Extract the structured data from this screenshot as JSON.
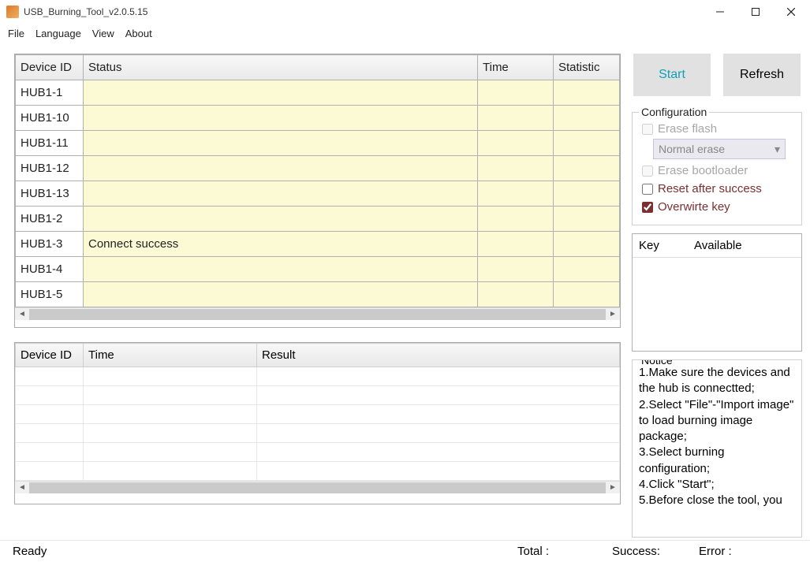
{
  "window": {
    "title": "USB_Burning_Tool_v2.0.5.15"
  },
  "menu": {
    "file": "File",
    "language": "Language",
    "view": "View",
    "about": "About"
  },
  "table1": {
    "headers": {
      "device": "Device ID",
      "status": "Status",
      "time": "Time",
      "statistic": "Statistic"
    },
    "rows": [
      {
        "device": "HUB1-1",
        "status": "",
        "time": "",
        "stat": ""
      },
      {
        "device": "HUB1-10",
        "status": "",
        "time": "",
        "stat": ""
      },
      {
        "device": "HUB1-11",
        "status": "",
        "time": "",
        "stat": ""
      },
      {
        "device": "HUB1-12",
        "status": "",
        "time": "",
        "stat": ""
      },
      {
        "device": "HUB1-13",
        "status": "",
        "time": "",
        "stat": ""
      },
      {
        "device": "HUB1-2",
        "status": "",
        "time": "",
        "stat": ""
      },
      {
        "device": "HUB1-3",
        "status": "Connect success",
        "time": "",
        "stat": ""
      },
      {
        "device": "HUB1-4",
        "status": "",
        "time": "",
        "stat": ""
      },
      {
        "device": "HUB1-5",
        "status": "",
        "time": "",
        "stat": ""
      }
    ]
  },
  "table2": {
    "headers": {
      "device": "Device ID",
      "time": "Time",
      "result": "Result"
    }
  },
  "buttons": {
    "start": "Start",
    "refresh": "Refresh"
  },
  "config": {
    "title": "Configuration",
    "erase_flash": "Erase flash",
    "erase_mode": "Normal erase",
    "erase_bootloader": "Erase bootloader",
    "reset": "Reset after success",
    "overwrite": "Overwirte key"
  },
  "keybox": {
    "key": "Key",
    "available": "Available"
  },
  "notice": {
    "title": "Notice",
    "l1": "1.Make sure the devices and the hub is connectted;",
    "l2": "2.Select \"File\"-\"Import image\" to load burning image package;",
    "l3": "3.Select burning configuration;",
    "l4": "4.Click \"Start\";",
    "l5": "5.Before close the tool, you"
  },
  "status": {
    "ready": "Ready",
    "total": "Total :",
    "success": "Success:",
    "error": "Error :"
  }
}
